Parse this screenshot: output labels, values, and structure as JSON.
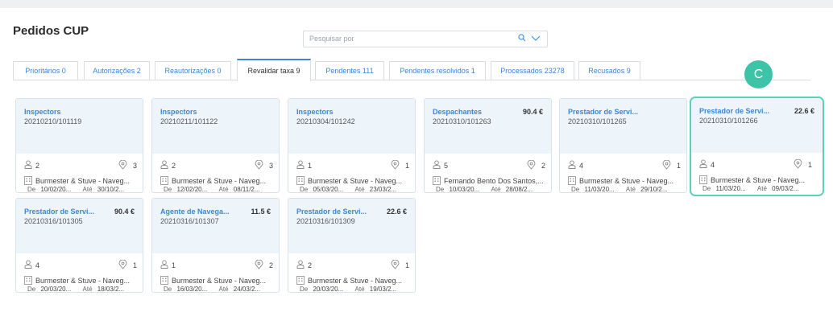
{
  "header": {
    "title": "Pedidos CUP"
  },
  "search": {
    "placeholder": "Pesquisar por"
  },
  "tabs": [
    {
      "label": "Prioritários 0"
    },
    {
      "label": "Autorizações 2"
    },
    {
      "label": "Reautorizações 0"
    },
    {
      "label": "Revalidar taxa 9",
      "active": true
    },
    {
      "label": "Pendentes 111"
    },
    {
      "label": "Pendentes resolvidos 1"
    },
    {
      "label": "Processados 23278"
    },
    {
      "label": "Recusados 9"
    }
  ],
  "avatar": {
    "initial": "C"
  },
  "labels": {
    "from": "De",
    "to": "Até"
  },
  "cards": [
    {
      "type": "Inspectors",
      "code": "20210210/101119",
      "price": "",
      "persons": "2",
      "locations": "3",
      "company": "Burmester & Stuve - Naveg...",
      "from": "10/02/20...",
      "to": "30/10/2..."
    },
    {
      "type": "Inspectors",
      "code": "20210211/101122",
      "price": "",
      "persons": "2",
      "locations": "3",
      "company": "Burmester & Stuve - Naveg...",
      "from": "12/02/20...",
      "to": "08/11/2..."
    },
    {
      "type": "Inspectors",
      "code": "20210304/101242",
      "price": "",
      "persons": "1",
      "locations": "1",
      "company": "Burmester & Stuve - Naveg...",
      "from": "05/03/20...",
      "to": "23/03/2..."
    },
    {
      "type": "Despachantes",
      "code": "20210310/101263",
      "price": "90.4 €",
      "persons": "5",
      "locations": "2",
      "company": "Fernando Bento Dos Santos,...",
      "from": "10/03/20...",
      "to": "28/08/2..."
    },
    {
      "type": "Prestador de Servi...",
      "code": "20210310/101265",
      "price": "",
      "persons": "4",
      "locations": "1",
      "company": "Burmester & Stuve - Naveg...",
      "from": "11/03/20...",
      "to": "29/10/2..."
    },
    {
      "type": "Prestador de Servi...",
      "code": "20210310/101266",
      "price": "22.6 €",
      "persons": "4",
      "locations": "1",
      "company": "Burmester & Stuve - Naveg...",
      "from": "11/03/20...",
      "to": "09/03/2..."
    },
    {
      "type": "Prestador de Servi...",
      "code": "20210316/101305",
      "price": "90.4 €",
      "persons": "4",
      "locations": "1",
      "company": "Burmester & Stuve - Naveg...",
      "from": "20/03/20...",
      "to": "18/03/2..."
    },
    {
      "type": "Agente de Navega...",
      "code": "20210316/101307",
      "price": "11.5 €",
      "persons": "1",
      "locations": "2",
      "company": "Burmester & Stuve - Naveg...",
      "from": "16/03/20...",
      "to": "24/03/2..."
    },
    {
      "type": "Prestador de Servi...",
      "code": "20210316/101309",
      "price": "22.6 €",
      "persons": "2",
      "locations": "1",
      "company": "Burmester & Stuve - Naveg...",
      "from": "20/03/20...",
      "to": "19/03/2..."
    }
  ]
}
